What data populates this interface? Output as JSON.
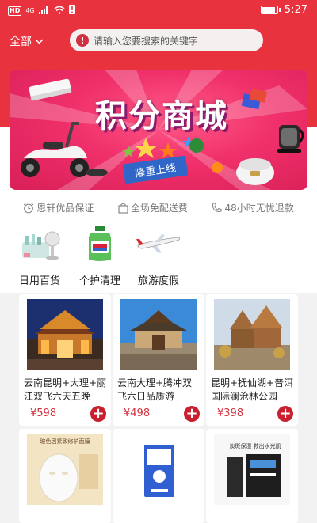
{
  "status_bar": {
    "hd": "HD",
    "network": "4G",
    "battery": "▮",
    "time": "5:27"
  },
  "search": {
    "city": "全部",
    "placeholder": "请输入您要搜索的关键字"
  },
  "banner": {
    "title": "积分商城",
    "subtitle": "隆重上线"
  },
  "trust": [
    {
      "icon": "alarm-clock-icon",
      "label": "恩轩优品保证"
    },
    {
      "icon": "shopping-bag-icon",
      "label": "全场免配送费"
    },
    {
      "icon": "phone-icon",
      "label": "48小时无忧退款"
    }
  ],
  "categories": [
    {
      "icon": "daily-goods-icon",
      "label": "日用百货"
    },
    {
      "icon": "personal-care-icon",
      "label": "个护清理"
    },
    {
      "icon": "airplane-icon",
      "label": "旅游度假"
    }
  ],
  "products": [
    {
      "name": "云南昆明+大理+丽江双飞六天五晚",
      "price": "¥598"
    },
    {
      "name": "云南大理+腾冲双飞六日品质游",
      "price": "¥498"
    },
    {
      "name": "昆明+抚仙湖+普洱国际澜沧林公园+野",
      "price": "¥398"
    },
    {
      "name": "玻色因紧致修护面膜",
      "price": ""
    },
    {
      "name": "",
      "price": ""
    },
    {
      "name": "",
      "price": ""
    }
  ],
  "product_images": {
    "card4_text": "玻色因紧致修护面膜",
    "card6_text": "淡斑保湿 救出水光肌"
  },
  "colors": {
    "brand_red": "#e8323e",
    "price_red": "#d2323e",
    "banner_pink": "#f0306a"
  }
}
